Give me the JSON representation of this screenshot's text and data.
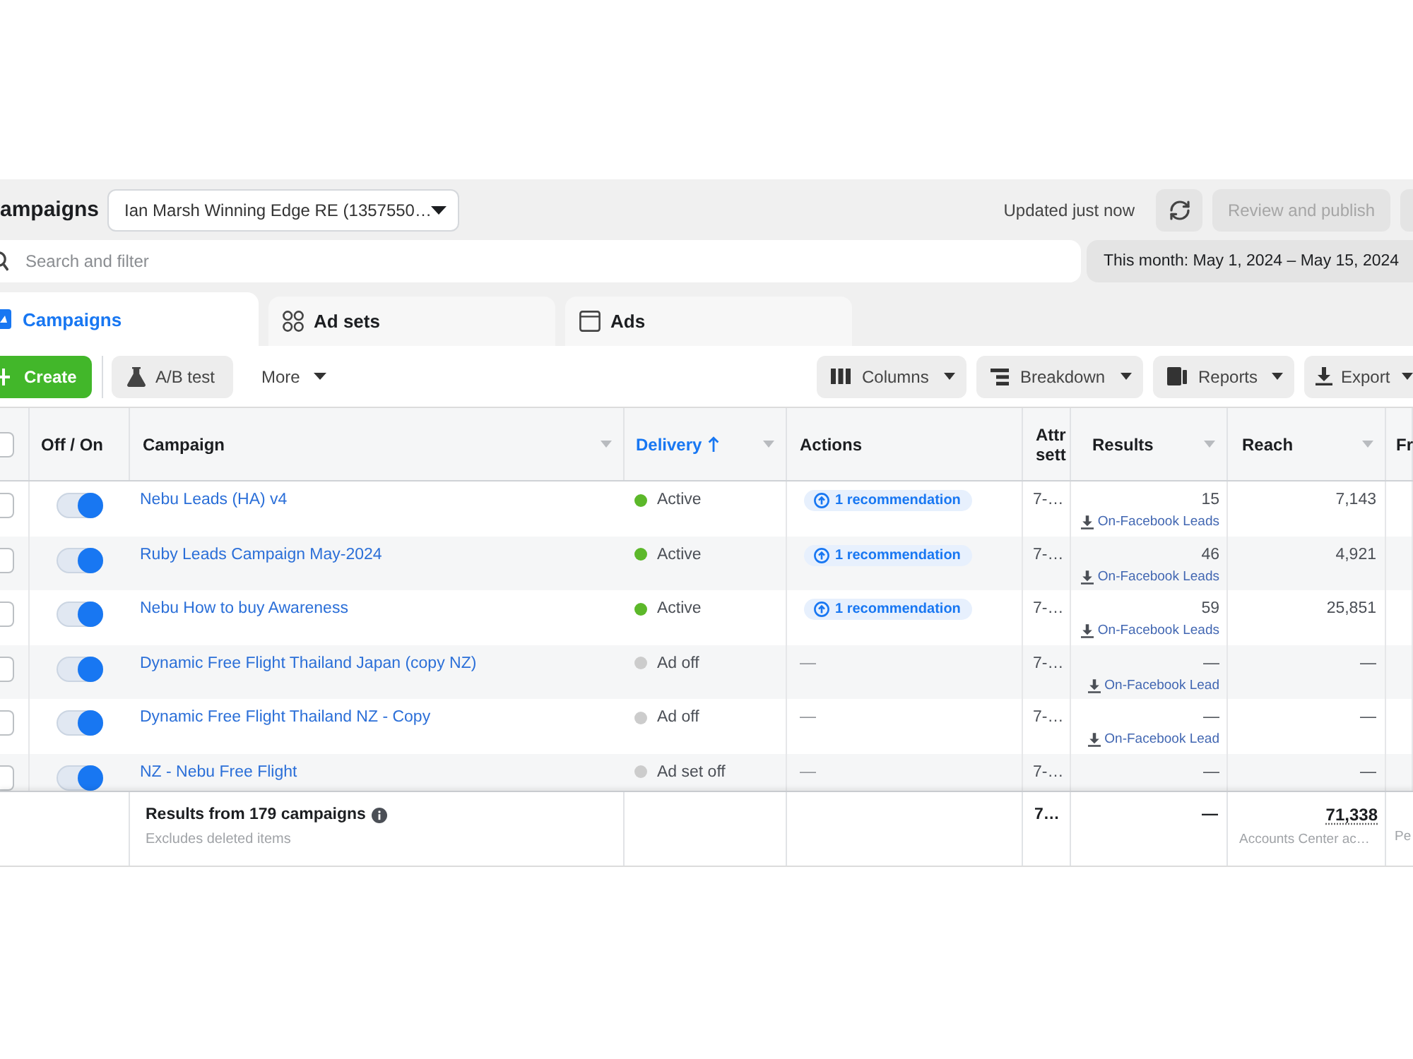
{
  "header": {
    "title": "ampaigns",
    "account": "Ian Marsh Winning Edge RE (1357550…",
    "status": "Updated just now",
    "publish_button": {
      "label": "Review and publish",
      "disabled": true
    }
  },
  "search": {
    "placeholder": "Search and filter"
  },
  "date_range": "This month: May 1, 2024 – May 15, 2024",
  "tabs": [
    {
      "label": "Campaigns",
      "selected": true
    },
    {
      "label": "Ad sets",
      "selected": false
    },
    {
      "label": "Ads",
      "selected": false
    }
  ],
  "toolbar": {
    "create": "Create",
    "ab_test": "A/B test",
    "more": "More",
    "views": [
      {
        "kind": "columns",
        "label": "Columns"
      },
      {
        "kind": "breakdown",
        "label": "Breakdown"
      },
      {
        "kind": "reports",
        "label": "Reports"
      },
      {
        "kind": "export",
        "label": "Export"
      }
    ]
  },
  "table": {
    "select_all": {
      "checked": false
    },
    "columns": [
      {
        "label": "Off / On",
        "sorted": false,
        "menu": false
      },
      {
        "label": "Campaign",
        "sorted": false,
        "menu": true
      },
      {
        "label": "Delivery",
        "sorted": true,
        "menu": true
      },
      {
        "label": "Actions",
        "sorted": false,
        "menu": false
      },
      {
        "label": "Attr sett",
        "sorted": false,
        "menu": false
      },
      {
        "label": "Results",
        "sorted": false,
        "menu": true
      },
      {
        "label": "Reach",
        "sorted": false,
        "menu": true
      },
      {
        "label": "Fr",
        "sorted": false,
        "menu": false
      }
    ],
    "rows": [
      {
        "checked": false,
        "on": true,
        "campaign": "Nebu Leads (HA) v4",
        "delivery": {
          "status": "Active",
          "color": "#5cb82a"
        },
        "actions": {
          "kind": "recommendation",
          "text": "1 recommendation"
        },
        "attribution": "7-…",
        "results": {
          "value": "15",
          "label": "On-Facebook Leads"
        },
        "reach": "7,143"
      },
      {
        "checked": false,
        "on": true,
        "campaign": "Ruby Leads Campaign May-2024",
        "delivery": {
          "status": "Active",
          "color": "#5cb82a"
        },
        "actions": {
          "kind": "recommendation",
          "text": "1 recommendation"
        },
        "attribution": "7-…",
        "results": {
          "value": "46",
          "label": "On-Facebook Leads"
        },
        "reach": "4,921"
      },
      {
        "checked": false,
        "on": true,
        "campaign": "Nebu How to buy Awareness",
        "delivery": {
          "status": "Active",
          "color": "#5cb82a"
        },
        "actions": {
          "kind": "recommendation",
          "text": "1 recommendation"
        },
        "attribution": "7-…",
        "results": {
          "value": "59",
          "label": "On-Facebook Leads"
        },
        "reach": "25,851"
      },
      {
        "checked": false,
        "on": true,
        "campaign": "Dynamic Free Flight Thailand Japan (copy NZ)",
        "delivery": {
          "status": "Ad off",
          "color": "#cccccc"
        },
        "actions": {
          "kind": "none",
          "text": "—"
        },
        "attribution": "7-…",
        "results": {
          "value": "—",
          "label": "On-Facebook Lead"
        },
        "reach": "—"
      },
      {
        "checked": false,
        "on": true,
        "campaign": "Dynamic Free Flight Thailand NZ - Copy",
        "delivery": {
          "status": "Ad off",
          "color": "#cccccc"
        },
        "actions": {
          "kind": "none",
          "text": "—"
        },
        "attribution": "7-…",
        "results": {
          "value": "—",
          "label": "On-Facebook Lead"
        },
        "reach": "—"
      },
      {
        "checked": false,
        "on": true,
        "campaign": "NZ - Nebu Free Flight",
        "delivery": {
          "status": "Ad set off",
          "color": "#cccccc"
        },
        "actions": {
          "kind": "none",
          "text": "—"
        },
        "attribution": "7-…",
        "results": {
          "value": "—"
        },
        "reach": "—"
      }
    ],
    "footer": {
      "title": "Results from 179 campaigns",
      "note": "Excludes deleted items",
      "attribution": "7…",
      "results": "—",
      "reach": "71,338",
      "reach_note": "Accounts Center ac…",
      "cut_column_note": "Pe"
    }
  }
}
